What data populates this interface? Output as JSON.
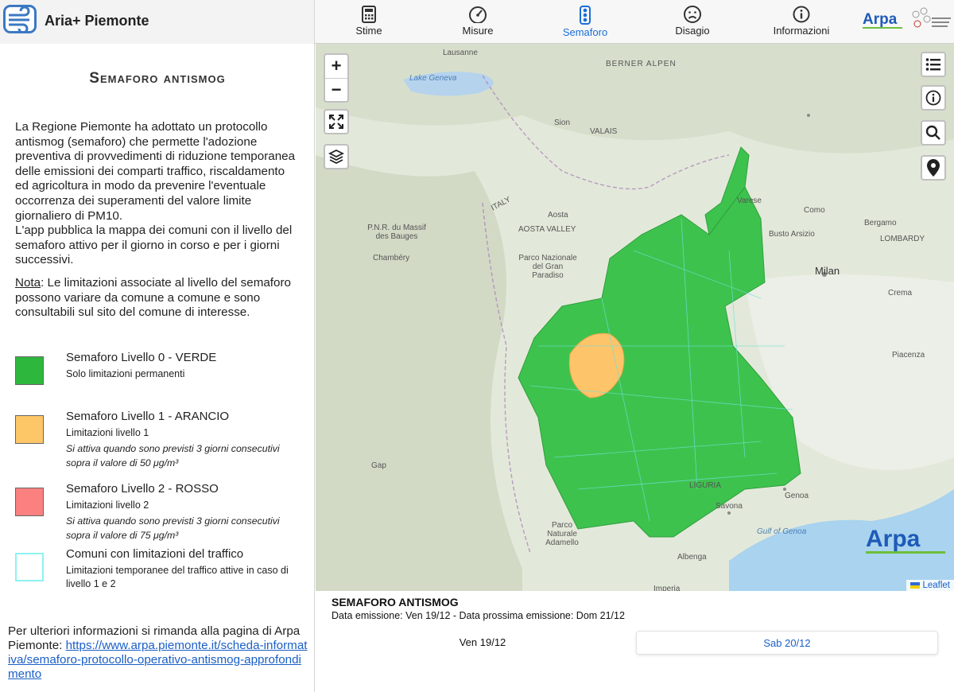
{
  "app": {
    "title": "Aria+ Piemonte"
  },
  "nav": {
    "tabs": [
      {
        "label": "Stime",
        "icon": "calculator-icon"
      },
      {
        "label": "Misure",
        "icon": "gauge-icon"
      },
      {
        "label": "Semaforo",
        "icon": "traffic-light-icon",
        "active": true
      },
      {
        "label": "Disagio",
        "icon": "sad-face-icon"
      },
      {
        "label": "Informazioni",
        "icon": "info-icon"
      }
    ],
    "brand": "Arpa"
  },
  "sidebar": {
    "title": "Semaforo antismog",
    "intro": "La Regione Piemonte ha adottato un protocollo antismog (semaforo) che permette l'adozione preventiva di provvedimenti di riduzione temporanea delle emissioni dei comparti traffico, riscaldamento ed agricoltura in modo da prevenire l'eventuale occorrenza dei superamenti del valore limite giornaliero di PM10.",
    "intro2": "L'app pubblica la mappa dei comuni con il livello del semaforo attivo per il giorno in corso e per i giorni successivi.",
    "note_label": "Nota",
    "note_text": ": Le limitazioni associate al livello del semaforo possono variare da comune a comune e sono consultabili sul sito del comune di interesse.",
    "legend": [
      {
        "title": "Semaforo Livello 0 - VERDE",
        "sub": "Solo limitazioni permanenti",
        "desc": "",
        "color": "#2db83d"
      },
      {
        "title": "Semaforo Livello 1 - ARANCIO",
        "sub": "Limitazioni livello 1",
        "desc": "Si attiva quando sono previsti 3 giorni consecutivi sopra il valore di 50 μg/m³",
        "color": "#fdc667"
      },
      {
        "title": "Semaforo Livello 2 - ROSSO",
        "sub": "Limitazioni livello 2",
        "desc": "Si attiva quando sono previsti 3 giorni consecutivi sopra il valore di 75 μg/m³",
        "color": "#fb8080"
      },
      {
        "title": "Comuni con limitazioni del traffico",
        "sub": "Limitazioni temporanee del traffico attive in caso di livello 1 e 2",
        "desc": "",
        "color": "#8ef2f2"
      }
    ],
    "more_text": "Per ulteriori informazioni si rimanda alla pagina di Arpa Piemonte: ",
    "more_link": "https://www.arpa.piemonte.it/scheda-informativa/semaforo-protocollo-operativo-antismog-approfondimento"
  },
  "map": {
    "zoom_in": "+",
    "zoom_out": "−",
    "attribution": "Leaflet",
    "labels": [
      "Lausanne",
      "Lake Geneva",
      "Sion",
      "VALAIS",
      "ITALY",
      "Aosta",
      "AOSTA VALLEY",
      "Chambéry",
      "Parco Nazionale del Gran Paradiso",
      "Milan",
      "Varese",
      "Como",
      "Bergamo",
      "Busto Arsizio",
      "LOMBARDY",
      "Crema",
      "Piacenza",
      "Genoa",
      "Savona",
      "LIGURIA",
      "Gulf of Genoa",
      "Albenga",
      "Imperia",
      "Gap",
      "BERNER ALPEN",
      "P.N.R. du Massif des Bauges",
      "Parco Naturale Adamello"
    ]
  },
  "panel": {
    "title": "SEMAFORO ANTISMOG",
    "info": "Data emissione: Ven 19/12 - Data prossima emissione: Dom 21/12",
    "days": [
      "Ven 19/12",
      "Sab 20/12"
    ]
  }
}
